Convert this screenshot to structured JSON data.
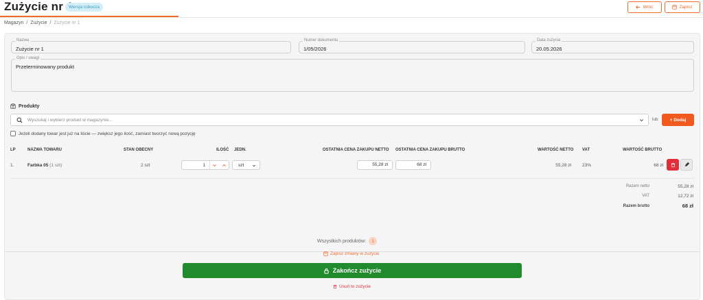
{
  "header": {
    "title": "Zużycie nr 1",
    "badge": "Wersja robocza",
    "back_label": "Wróć",
    "save_label": "Zapisz"
  },
  "breadcrumb": [
    "Magazyn",
    "Zużycie",
    "Zużycie nr 1"
  ],
  "form": {
    "name": {
      "label": "Nazwa",
      "value": "Zużycie nr 1"
    },
    "doc_number": {
      "label": "Numer dokumentu",
      "value": "1/05/2026"
    },
    "date": {
      "label": "Data zużycia",
      "value": "20.05.2026"
    },
    "notes": {
      "label": "Opis / uwagi",
      "value": "Przeterminowany produkt"
    }
  },
  "products": {
    "heading": "Produkty",
    "search_placeholder": "Wyszukaj i wybierz produkt w magazynie...",
    "or_label": "lub",
    "add_label": "Dodaj",
    "merge_checkbox_label": "Jeżeli dodany towar jest już na liście — zwiększ jego ilość, zamiast tworzyć nową pozycję",
    "columns": {
      "lp": "LP",
      "name": "NAZWA TOWARU",
      "stock": "STAN OBECNY",
      "qty": "ILOŚĆ",
      "unit": "JEDN.",
      "last_net": "OSTATNIA CENA ZAKUPU NETTO",
      "last_gross": "OSTATNIA CENA ZAKUPU BRUTTO",
      "value_net": "WARTOŚĆ NETTO",
      "vat": "VAT",
      "value_gross": "WARTOŚĆ BRUTTO"
    },
    "rows": [
      {
        "lp": "1.",
        "name": "Farbka 05",
        "name_note": "(1 szt)",
        "stock": "2 szt",
        "qty": "1",
        "unit": "szt",
        "last_net": "55,28 zł",
        "last_gross": "68 zł",
        "value_net": "55,28 zł",
        "vat": "23%",
        "value_gross": "68 zł"
      }
    ],
    "totals": {
      "net_label": "Razem netto",
      "net_value": "55,28 zł",
      "vat_label": "VAT",
      "vat_value": "12,72 zł",
      "gross_label": "Razem brutto",
      "gross_value": "68 zł"
    }
  },
  "footer": {
    "all_products_label": "Wszystkich produktów:",
    "all_products_count": "1",
    "save_changes_label": "Zapisz zmiany w zużyciu",
    "finish_label": "Zakończ zużycie",
    "delete_label": "Usuń to zużycie"
  },
  "colors": {
    "accent": "#f06a2c",
    "success": "#218a2c",
    "danger": "#e02f3a",
    "badge_bg": "#d4eef7"
  }
}
